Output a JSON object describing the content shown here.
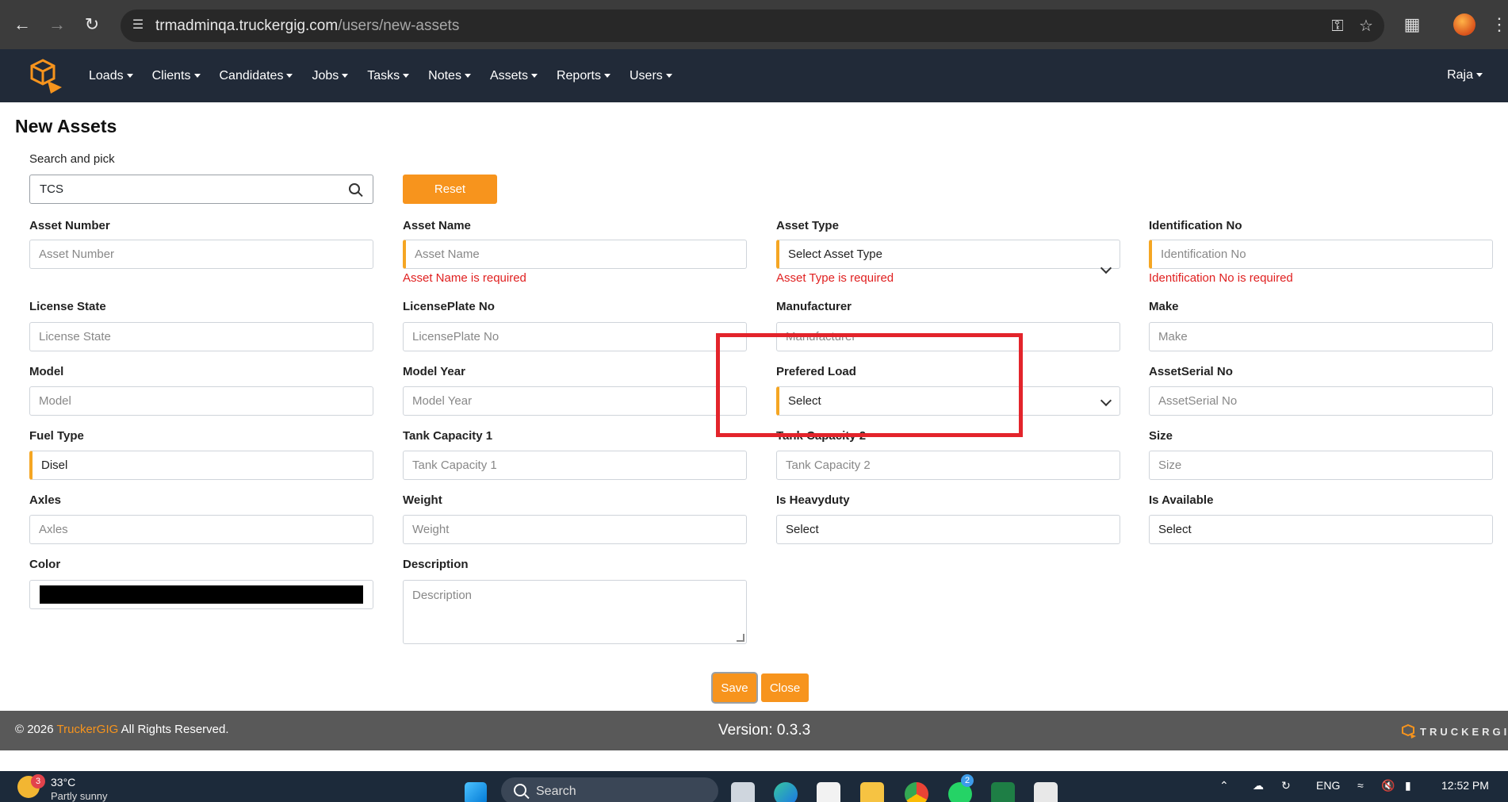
{
  "browser": {
    "url_host": "trmadminqa.truckergig.com",
    "url_path": "/users/new-assets"
  },
  "navbar": {
    "items": [
      {
        "label": "Loads"
      },
      {
        "label": "Clients"
      },
      {
        "label": "Candidates"
      },
      {
        "label": "Jobs"
      },
      {
        "label": "Tasks"
      },
      {
        "label": "Notes"
      },
      {
        "label": "Assets"
      },
      {
        "label": "Reports"
      },
      {
        "label": "Users"
      }
    ],
    "user": "Raja"
  },
  "page": {
    "title": "New Assets",
    "search_label": "Search and pick",
    "search_value": "TCS",
    "reset_label": "Reset"
  },
  "form": {
    "asset_number": {
      "label": "Asset Number",
      "placeholder": "Asset Number"
    },
    "asset_name": {
      "label": "Asset Name",
      "placeholder": "Asset Name",
      "error": "Asset Name is required"
    },
    "asset_type": {
      "label": "Asset Type",
      "value": "Select Asset Type",
      "error": "Asset Type is required"
    },
    "identification_no": {
      "label": "Identification No",
      "placeholder": "Identification No",
      "error": "Identification No is required"
    },
    "license_state": {
      "label": "License State",
      "placeholder": "License State"
    },
    "license_plate": {
      "label": "LicensePlate No",
      "placeholder": "LicensePlate No"
    },
    "manufacturer": {
      "label": "Manufacturer",
      "placeholder": "Manufacturer"
    },
    "make": {
      "label": "Make",
      "placeholder": "Make"
    },
    "model": {
      "label": "Model",
      "placeholder": "Model"
    },
    "model_year": {
      "label": "Model Year",
      "placeholder": "Model Year"
    },
    "prefered_load": {
      "label": "Prefered Load",
      "value": "Select"
    },
    "asset_serial": {
      "label": "AssetSerial No",
      "placeholder": "AssetSerial No"
    },
    "fuel_type": {
      "label": "Fuel Type",
      "value": "Disel"
    },
    "tank_capacity_1": {
      "label": "Tank Capacity 1",
      "placeholder": "Tank Capacity 1"
    },
    "tank_capacity_2": {
      "label": "Tank Capacity 2",
      "placeholder": "Tank Capacity 2"
    },
    "size": {
      "label": "Size",
      "placeholder": "Size"
    },
    "axles": {
      "label": "Axles",
      "placeholder": "Axles"
    },
    "weight": {
      "label": "Weight",
      "placeholder": "Weight"
    },
    "is_heavyduty": {
      "label": "Is Heavyduty",
      "value": "Select"
    },
    "is_available": {
      "label": "Is Available",
      "value": "Select"
    },
    "color": {
      "label": "Color",
      "value": "#000000"
    },
    "description": {
      "label": "Description",
      "placeholder": "Description"
    },
    "save_label": "Save",
    "close_label": "Close"
  },
  "footer": {
    "copyright_prefix": "© 2026",
    "brand": "TruckerGIG",
    "copyright_suffix": "All Rights Reserved.",
    "version": "Version: 0.3.3",
    "logo_text": "TRUCKERGIG"
  },
  "taskbar": {
    "weather_badge": "3",
    "temperature": "33°C",
    "condition": "Partly sunny",
    "search_label": "Search",
    "whatsapp_badge": "2",
    "language": "ENG",
    "time": "12:52 PM"
  },
  "colors": {
    "accent": "#f7941d",
    "navbar": "#212a38",
    "error": "#e02020",
    "highlight": "#e3242b"
  }
}
